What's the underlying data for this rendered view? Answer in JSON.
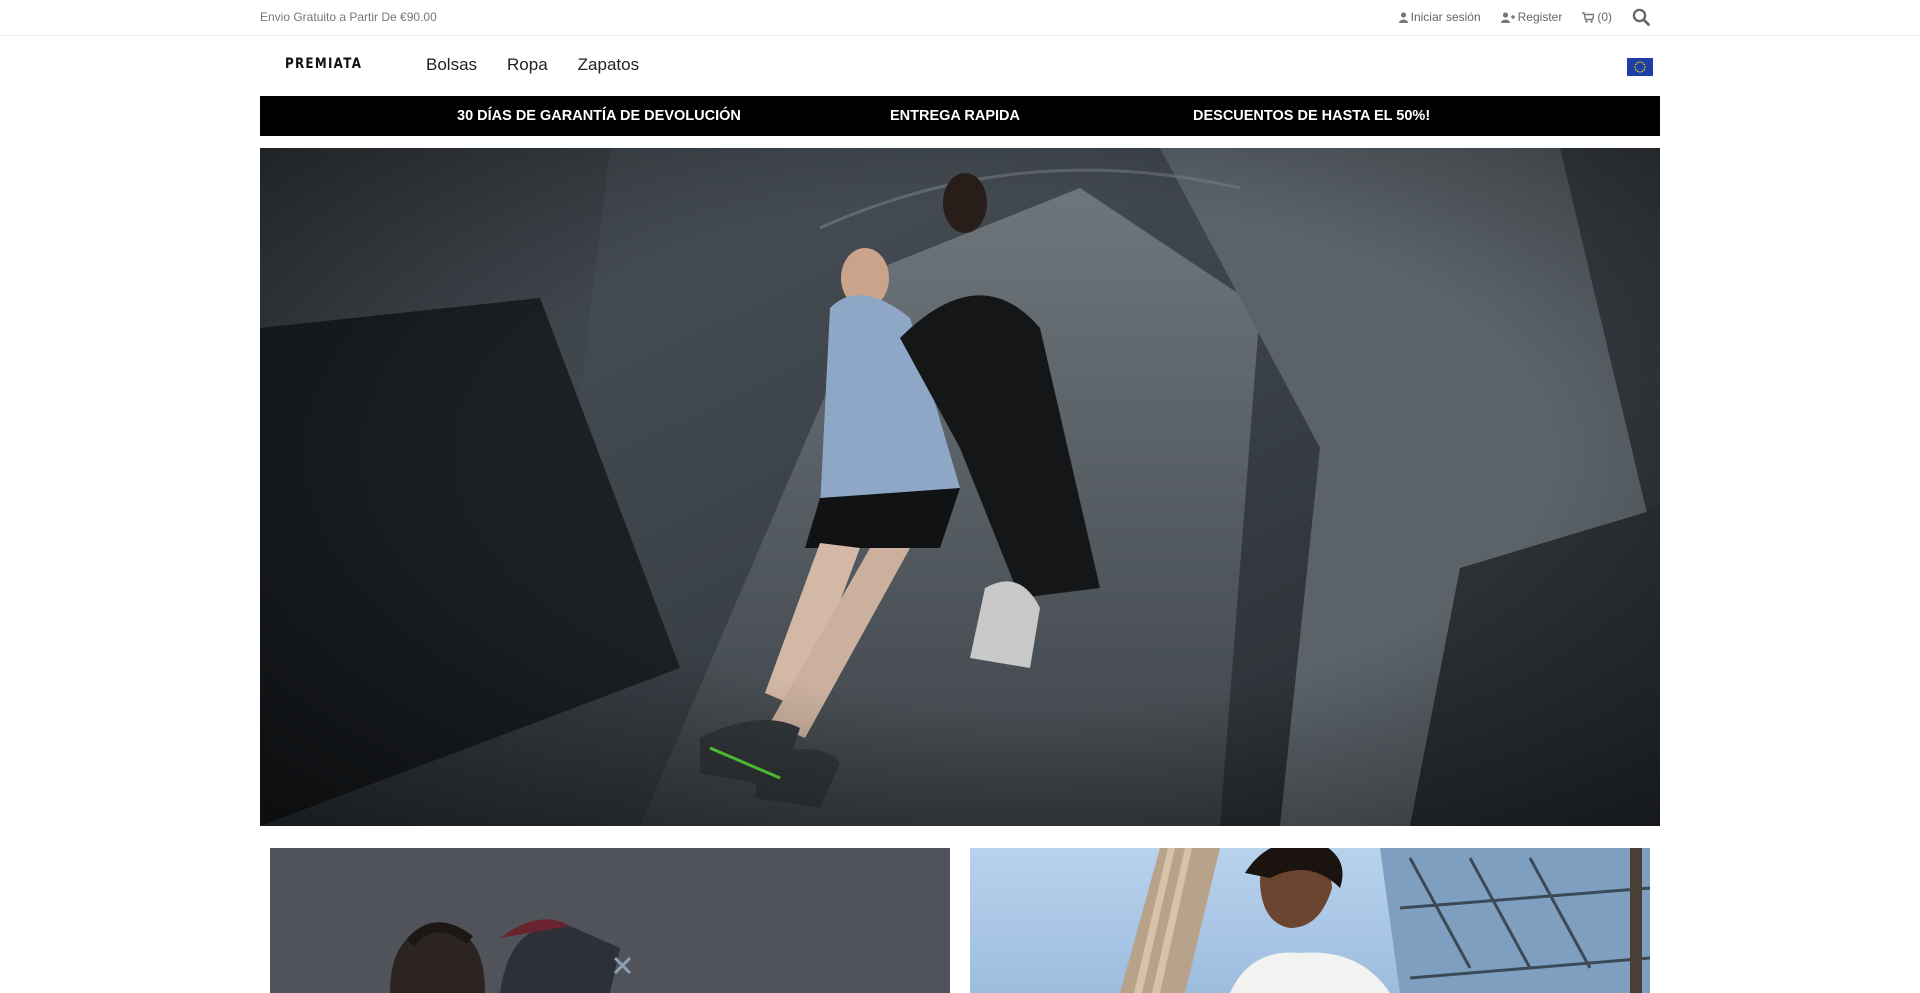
{
  "topbar": {
    "promo": "Envio Gratuito a Partir De €90.00",
    "login_label": "Iniciar sesión",
    "register_label": "Register",
    "cart_label": "(0)"
  },
  "brand": {
    "logo_text": "PREMIATA"
  },
  "nav": {
    "items": [
      "Bolsas",
      "Ropa",
      "Zapatos"
    ]
  },
  "benefits": [
    "30 DÍAS DE GARANTÍA DE DEVOLUCIÓN",
    "ENTREGA RAPIDA",
    "DESCUENTOS DE HASTA EL 50%!"
  ],
  "colors": {
    "banner_bg": "#000000",
    "banner_text": "#ffffff",
    "flag_eu": "#1e3fa8",
    "flag_stars": "#ffd200"
  },
  "icons": {
    "login": "user-icon",
    "register": "user-plus-icon",
    "cart": "shopping-cart-icon",
    "search": "search-icon",
    "region": "eu-flag-icon"
  }
}
